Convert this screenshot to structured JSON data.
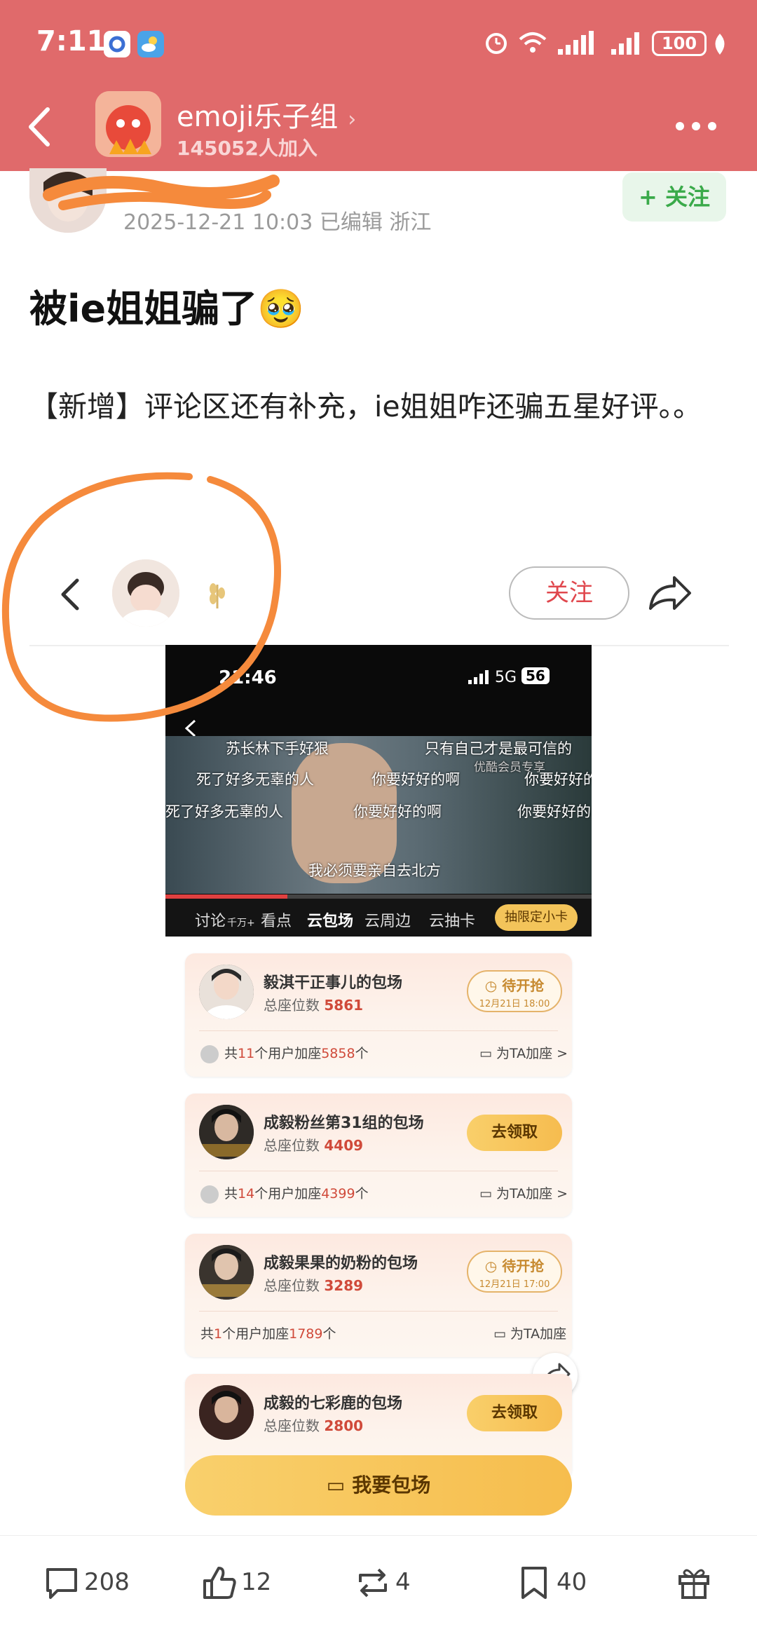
{
  "status_bar": {
    "time": "7:11",
    "battery": "100"
  },
  "header": {
    "group_name": "emoji乐子组",
    "member_count": "145052人加入"
  },
  "post": {
    "meta": "2025-12-21 10:03  已编辑  浙江",
    "follow_label": "+ 关注",
    "title": "被ie姐姐骗了🥹",
    "body": "【新增】评论区还有补充，ie姐姐咋还骗五星好评。。"
  },
  "inner": {
    "follow_label": "关注"
  },
  "screenshot": {
    "time": "21:46",
    "network": "5G",
    "signal_badge": "56",
    "danmaku": [
      "苏长林下手好狠",
      "只有自己才是最可信的",
      "优酷会员专享",
      "死了好多无辜的人",
      "你要好好的啊",
      "你要好好的",
      "死了好多无辜的人",
      "你要好好的啊",
      "你要好好的",
      "我必须要亲自去北方"
    ],
    "tabs": [
      {
        "label": "讨论",
        "suffix": "千万+"
      },
      {
        "label": "看点"
      },
      {
        "label": "云包场"
      },
      {
        "label": "云周边"
      },
      {
        "label": "云抽卡"
      }
    ],
    "tab_button": "抽限定小卡",
    "cards": [
      {
        "title": "毅淇干正事儿的包场",
        "seats_label": "总座位数 ",
        "seats": "5861",
        "status": "pending",
        "pending_label": "待开抢",
        "pending_date": "12月21日 18:00",
        "users_prefix": "共",
        "users": "11",
        "users_mid": "个用户加座",
        "added": "5858",
        "users_suffix": "个",
        "add_label": "为TA加座 >"
      },
      {
        "title": "成毅粉丝第31组的包场",
        "seats_label": "总座位数 ",
        "seats": "4409",
        "status": "claim",
        "claim_label": "去领取",
        "users_prefix": "共",
        "users": "14",
        "users_mid": "个用户加座",
        "added": "4399",
        "users_suffix": "个",
        "add_label": "为TA加座 >"
      },
      {
        "title": "成毅果果的奶粉的包场",
        "seats_label": "总座位数 ",
        "seats": "3289",
        "status": "pending",
        "pending_label": "待开抢",
        "pending_date": "12月21日 17:00",
        "users_prefix": "共",
        "users": "1",
        "users_mid": "个用户加座",
        "added": "1789",
        "users_suffix": "个",
        "add_label": "为TA加座"
      },
      {
        "title": "成毅的七彩鹿的包场",
        "seats_label": "总座位数 ",
        "seats": "2800",
        "status": "claim",
        "claim_label": "去领取"
      }
    ],
    "book_button": "我要包场"
  },
  "bottom_bar": {
    "comments": "208",
    "likes": "12",
    "reposts": "4",
    "favorites": "40"
  },
  "colors": {
    "header_bg": "#e06a6b",
    "follow_green": "#3aaa4a",
    "accent_red": "#e0474d",
    "annotation_orange": "#f58a3c"
  }
}
